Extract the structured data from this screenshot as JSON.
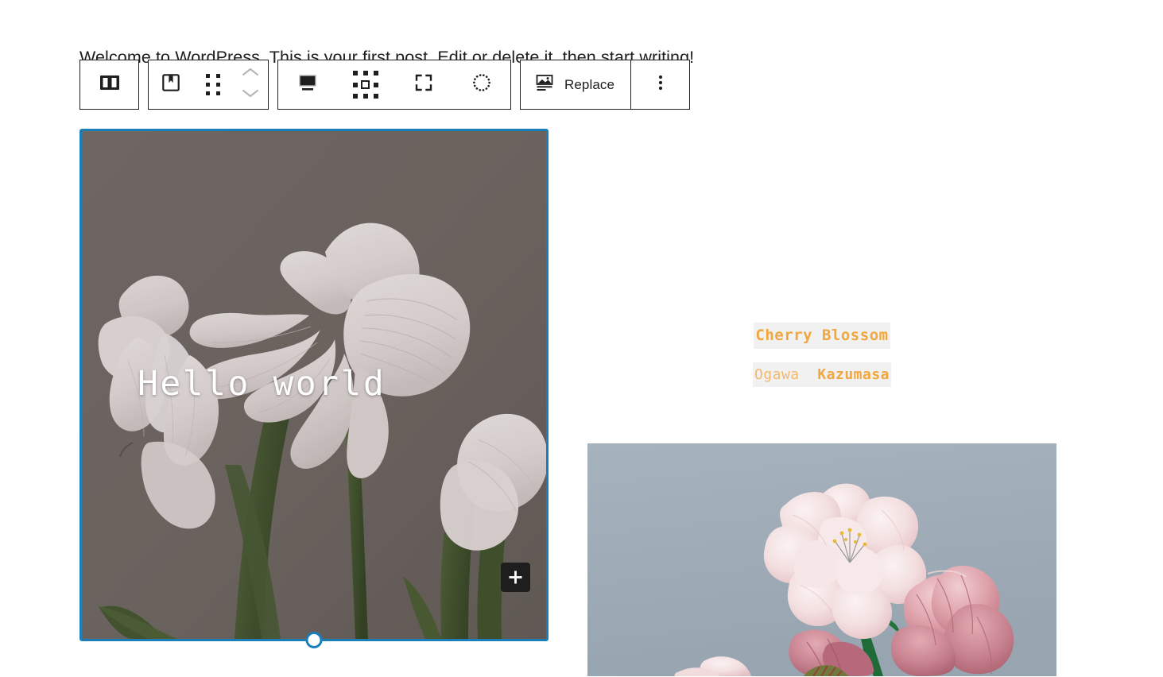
{
  "intro": {
    "text": "Welcome to WordPress. This is your first post. Edit or delete it, then start writing!"
  },
  "toolbar": {
    "block_type_button": {
      "name": "media-and-text-block",
      "label": ""
    },
    "block_icon_button": {
      "name": "cover-block",
      "label": ""
    },
    "drag_handle": {
      "label": ""
    },
    "move_up_label": "",
    "move_down_label": "",
    "align_button": "",
    "grid_button": "",
    "crop_button": "",
    "focal_point_button": "",
    "replace_label": "Replace",
    "options_label": ""
  },
  "cover": {
    "title": "Hello world",
    "appender_label": "+",
    "selection_color": "#1a7fb8",
    "overlay_color": "#6b6460"
  },
  "caption": {
    "title": "Cherry Blossom",
    "author_first": "Ogawa",
    "author_last": "Kazumasa",
    "accent_color": "#f0a73f",
    "highlight_background": "#f1f1f1"
  },
  "blossom": {
    "sky_color": "#9fadb8",
    "petal_color": "#f3dcdd"
  }
}
